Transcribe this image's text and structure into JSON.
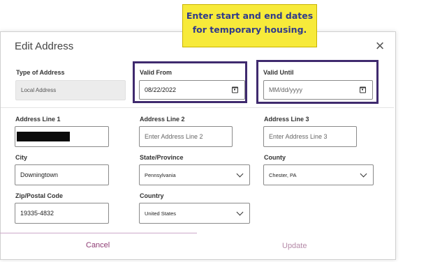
{
  "callout": {
    "line1": "Enter start and end dates",
    "line2": "for temporary housing."
  },
  "modal": {
    "title": "Edit Address",
    "close_icon": "close-icon"
  },
  "form": {
    "type_of_address": {
      "label": "Type of Address",
      "value": "Local Address"
    },
    "valid_from": {
      "label": "Valid From",
      "value": "08/22/2022",
      "icon": "calendar-icon"
    },
    "valid_until": {
      "label": "Valid Until",
      "placeholder": "MM/dd/yyyy",
      "icon": "calendar-icon"
    },
    "address_line_1": {
      "label": "Address Line 1",
      "value": ""
    },
    "address_line_2": {
      "label": "Address Line 2",
      "placeholder": "Enter Address Line 2"
    },
    "address_line_3": {
      "label": "Address Line 3",
      "placeholder": "Enter Address Line 3"
    },
    "city": {
      "label": "City",
      "value": "Downingtown"
    },
    "state_province": {
      "label": "State/Province",
      "value": "Pennsylvania",
      "icon": "chevron-down-icon"
    },
    "county": {
      "label": "County",
      "value": "Chester, PA",
      "icon": "chevron-down-icon"
    },
    "zip": {
      "label": "Zip/Postal Code",
      "value": "19335-4832"
    },
    "country": {
      "label": "Country",
      "value": "United States",
      "icon": "chevron-down-icon"
    }
  },
  "footer": {
    "cancel_label": "Cancel",
    "update_label": "Update"
  },
  "colors": {
    "callout_bg": "#f7ea3a",
    "callout_text": "#2f3a8c",
    "highlight_border": "#3f2a6e",
    "cancel_text": "#8e3b73",
    "update_text": "#b58aa8"
  }
}
